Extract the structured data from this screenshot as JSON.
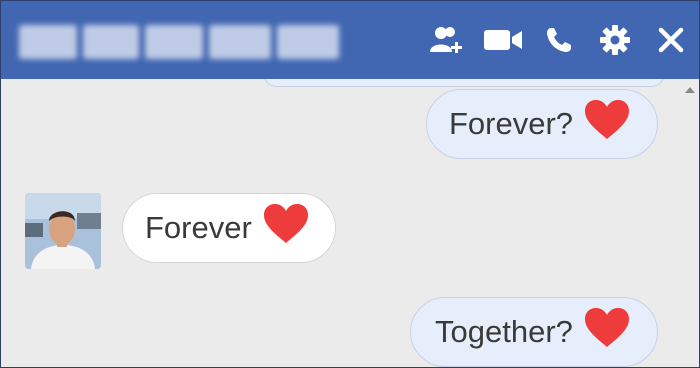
{
  "header": {
    "contact_name_blurred": true,
    "icons": [
      "add-person-icon",
      "video-call-icon",
      "phone-icon",
      "gear-icon",
      "close-icon"
    ]
  },
  "messages": [
    {
      "direction": "outgoing",
      "text": "Forever?",
      "emoji": "heart"
    },
    {
      "direction": "incoming",
      "text": "Forever",
      "emoji": "heart"
    },
    {
      "direction": "outgoing",
      "text": "Together?",
      "emoji": "heart"
    }
  ],
  "colors": {
    "header_bg": "#4267b2",
    "outgoing_bubble": "#e7eefb",
    "incoming_bubble": "#ffffff",
    "heart": "#ee3b3b",
    "chat_bg": "#ebebec"
  }
}
